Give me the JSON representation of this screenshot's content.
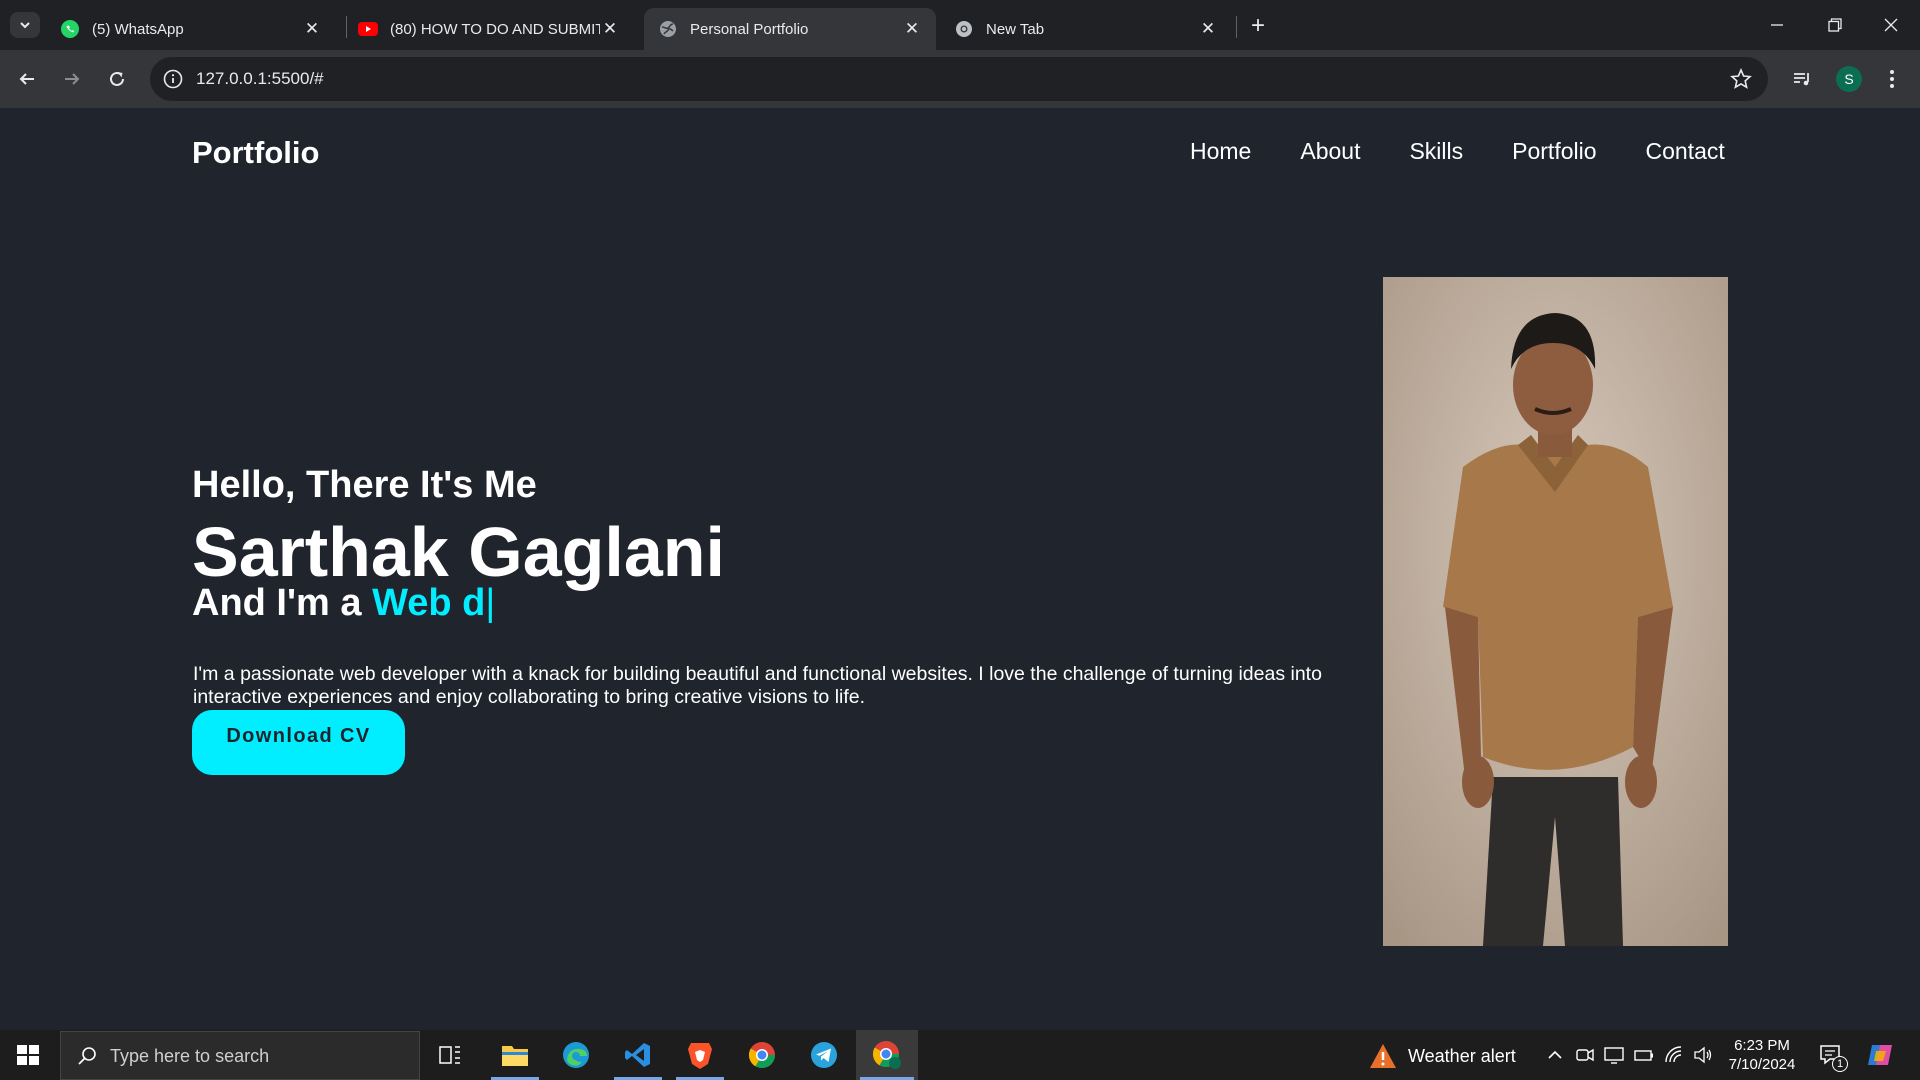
{
  "browser": {
    "tabs": [
      {
        "title": "(5) WhatsApp",
        "favicon": "whatsapp-icon",
        "active": false
      },
      {
        "title": "(80) HOW TO DO AND SUBMIT",
        "favicon": "youtube-icon",
        "active": false
      },
      {
        "title": "Personal Portfolio",
        "favicon": "globe-icon",
        "active": true
      },
      {
        "title": "New Tab",
        "favicon": "chrome-icon",
        "active": false
      }
    ],
    "url": "127.0.0.1:5500/#",
    "profile_initial": "S"
  },
  "site": {
    "logo": "Portfolio",
    "nav": [
      "Home",
      "About",
      "Skills",
      "Portfolio",
      "Contact"
    ],
    "hero": {
      "greeting": "Hello, There It's Me",
      "name": "Sarthak Gaglani",
      "role_prefix": "And I'm a",
      "role_typed": "Web d",
      "cursor": "|",
      "description": "I'm a passionate web developer with a knack for building beautiful and functional websites. I love the challenge of turning ideas into interactive experiences and enjoy collaborating to bring creative visions to life.",
      "cta": "Download CV"
    },
    "colors": {
      "background": "#1f242d",
      "accent": "#00eeff",
      "text": "#ffffff"
    }
  },
  "taskbar": {
    "search_placeholder": "Type here to search",
    "apps": [
      "task-view-icon",
      "file-explorer-icon",
      "edge-icon",
      "vscode-icon",
      "brave-icon",
      "chrome-icon",
      "telegram-icon",
      "chrome-profile-icon"
    ],
    "weather": "Weather alert",
    "time": "6:23 PM",
    "date": "7/10/2024",
    "notification_count": "1"
  }
}
